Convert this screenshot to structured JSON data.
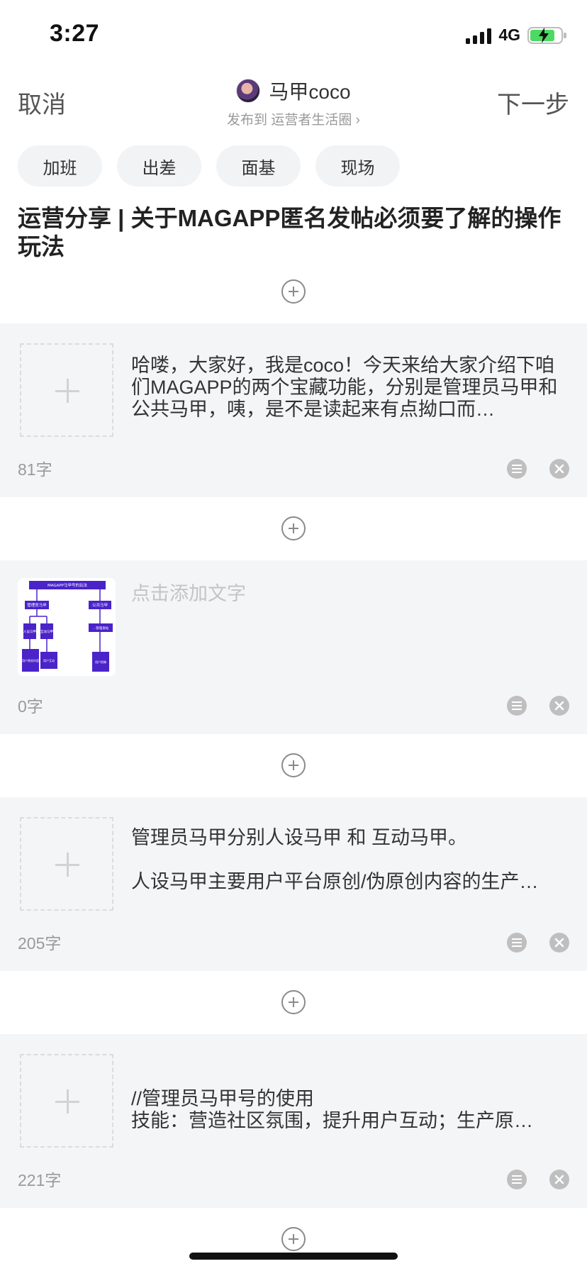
{
  "status_bar": {
    "time": "3:27",
    "network": "4G"
  },
  "nav": {
    "cancel_label": "取消",
    "next_label": "下一步",
    "user_name": "马甲coco",
    "publish_target": "发布到 运营者生活圈 ›"
  },
  "tags": [
    "加班",
    "出差",
    "面基",
    "现场"
  ],
  "post": {
    "title": "运营分享 | 关于MAGAPP匿名发帖必须要了解的操作玩法"
  },
  "blocks": [
    {
      "text": "哈喽，大家好，我是coco！今天来给大家介绍下咱们MAGAPP的两个宝藏功能，分别是管理员马甲和公共马甲，咦，是不是读起来有点拗口而…",
      "count": "81字"
    },
    {
      "text": "点击添加文字",
      "count": "0字",
      "image_texts": {
        "title": "MAGAPP马甲号的玩法",
        "left_head": "管理员马甲",
        "right_head": "公共马甲",
        "l1": "人设马甲",
        "l2": "互动马甲",
        "r1": "…管理发帖",
        "b1": "用户原创内容",
        "b2": "用户互动",
        "b3": "用户投稿"
      }
    },
    {
      "text": "管理员马甲分别人设马甲  和 互动马甲。\n\n人设马甲主要用户平台原创/伪原创内容的生产…",
      "count": "205字"
    },
    {
      "text": "//管理员马甲号的使用\n技能：营造社区氛围，提升用户互动；生产原…",
      "count": "221字"
    }
  ],
  "colors": {
    "block_bg": "#f4f5f7",
    "tag_bg": "#f2f3f5",
    "flowchart": "#4a23c9",
    "battery": "#4cd964"
  }
}
